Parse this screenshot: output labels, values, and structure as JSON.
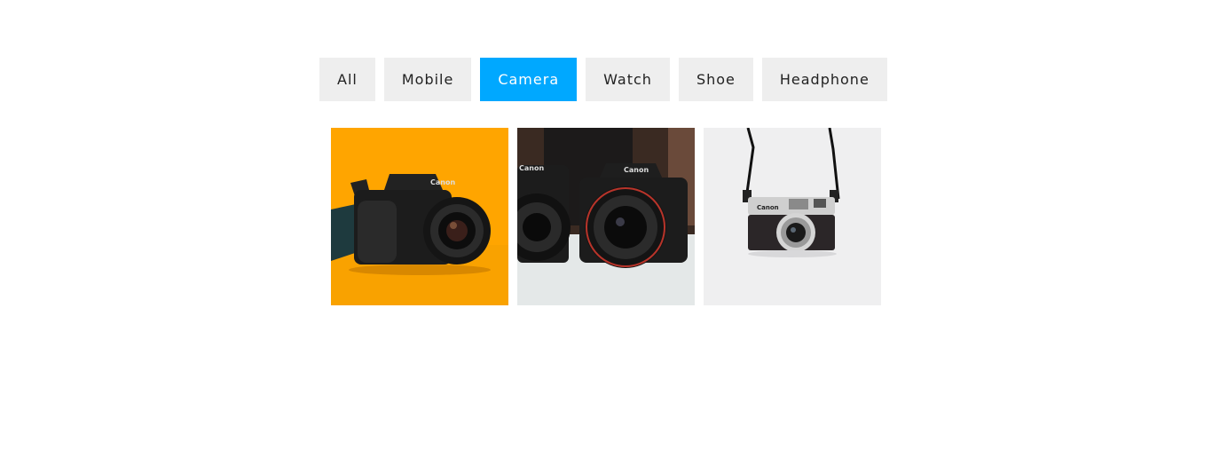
{
  "filters": [
    {
      "label": "All",
      "active": false
    },
    {
      "label": "Mobile",
      "active": false
    },
    {
      "label": "Camera",
      "active": true
    },
    {
      "label": "Watch",
      "active": false
    },
    {
      "label": "Shoe",
      "active": false
    },
    {
      "label": "Headphone",
      "active": false
    }
  ],
  "colors": {
    "active_filter_bg": "#00a8ff",
    "inactive_filter_bg": "#eeeeee",
    "filter_text": "#222222"
  },
  "gallery": {
    "items": [
      {
        "brand": "Canon",
        "background": "#ffa500",
        "subject": "dslr-camera"
      },
      {
        "brand": "Canon",
        "background": "#d8dede",
        "subject": "dslr-cameras-pair"
      },
      {
        "brand": "Canon",
        "background": "#efeff0",
        "subject": "rangefinder-camera"
      }
    ]
  }
}
